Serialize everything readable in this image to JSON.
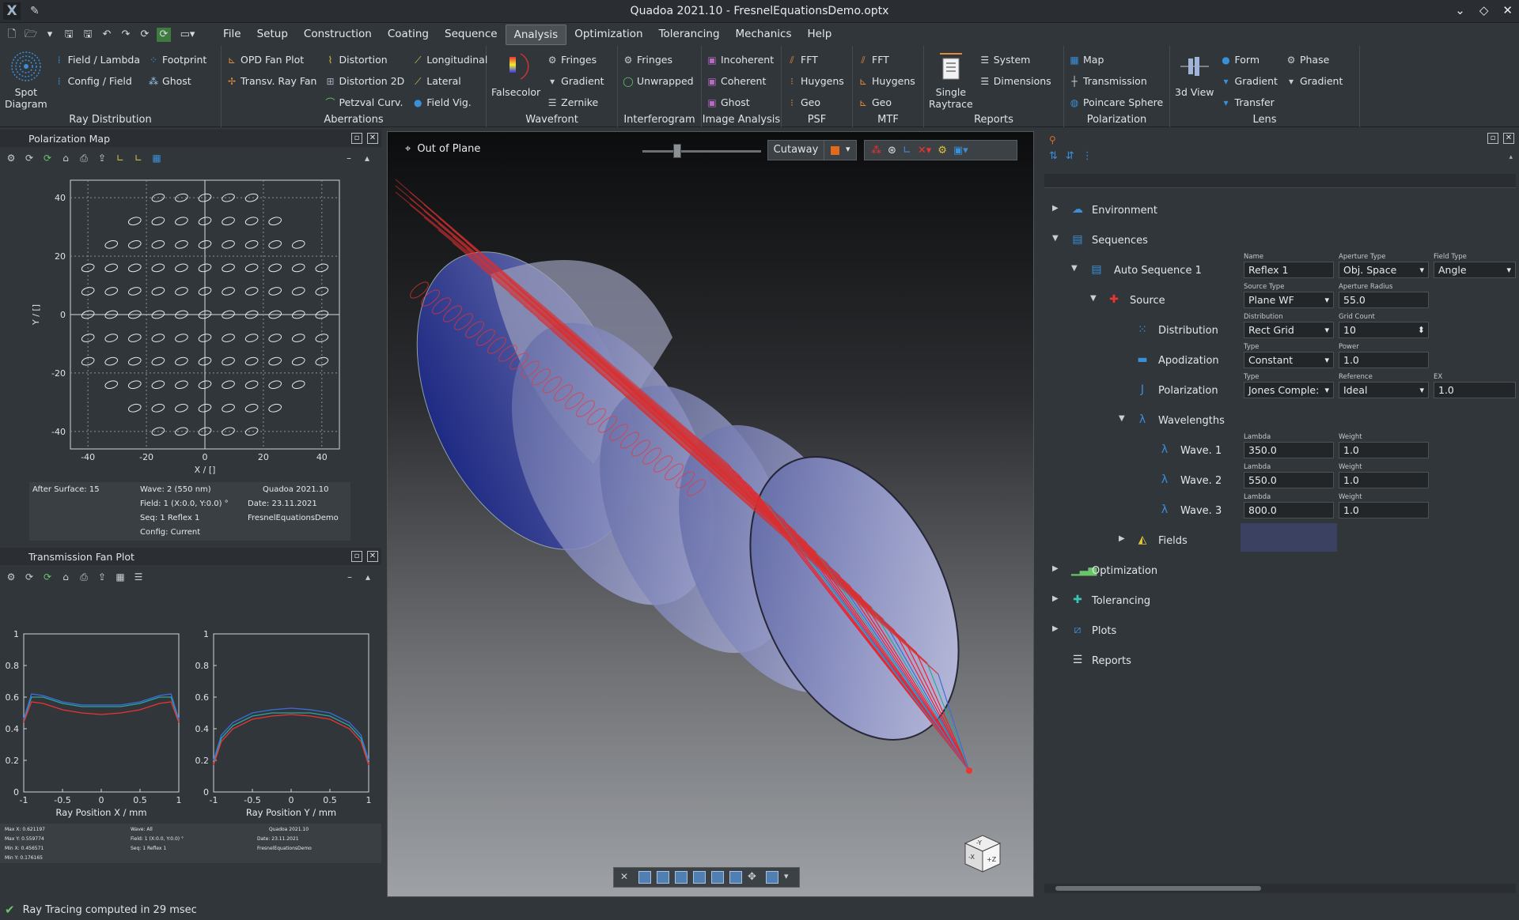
{
  "window": {
    "title": "Quadoa 2021.10 - FresnelEquationsDemo.optx"
  },
  "menu": [
    "File",
    "Setup",
    "Construction",
    "Coating",
    "Sequence",
    "Analysis",
    "Optimization",
    "Tolerancing",
    "Mechanics",
    "Help"
  ],
  "active_menu": "Analysis",
  "ribbon": {
    "ray_distribution": {
      "label": "Ray Distribution",
      "spot": "Spot\nDiagram",
      "items": [
        "Field / Lambda",
        "Config / Field",
        "Footprint",
        "Ghost"
      ]
    },
    "aberrations": {
      "label": "Aberrations",
      "items": [
        "OPD Fan Plot",
        "Transv. Ray Fan",
        "Distortion",
        "Distortion 2D",
        "Petzval Curv.",
        "Longitudinal",
        "Lateral",
        "Field Vig."
      ]
    },
    "wavefront": {
      "label": "Wavefront",
      "falsecolor": "Falsecolor",
      "items": [
        "Fringes",
        "Gradient",
        "Zernike"
      ]
    },
    "interferogram": {
      "label": "Interferogram",
      "items": [
        "Fringes",
        "Unwrapped"
      ]
    },
    "image_analysis": {
      "label": "Image Analysis",
      "items": [
        "Incoherent",
        "Coherent",
        "Ghost"
      ]
    },
    "psf": {
      "label": "PSF",
      "items": [
        "FFT",
        "Huygens",
        "Geo"
      ]
    },
    "mtf": {
      "label": "MTF",
      "items": [
        "FFT",
        "Huygens",
        "Geo"
      ]
    },
    "reports": {
      "label": "Reports",
      "single": "Single\nRaytrace",
      "items": [
        "System",
        "Dimensions"
      ]
    },
    "polarization": {
      "label": "Polarization",
      "items": [
        "Map",
        "Transmission",
        "Poincare Sphere"
      ]
    },
    "lens": {
      "label": "Lens",
      "view3d": "3d View",
      "items": [
        "Form",
        "Gradient",
        "Transfer",
        "Phase",
        "Gradient"
      ]
    }
  },
  "polmap": {
    "title": "Polarization Map",
    "xlabel": "X / []",
    "ylabel": "Y / []",
    "xticks": [
      "-40",
      "-20",
      "0",
      "20",
      "40"
    ],
    "yticks": [
      "40",
      "20",
      "0",
      "-20",
      "-40"
    ],
    "info": {
      "surface": "After Surface: 15",
      "wave": "Wave: 2 (550 nm)",
      "field": "Field: 1 (X:0.0, Y:0.0) °",
      "seq": "Seq: 1 Reflex 1",
      "config": "Config: Current",
      "version": "Quadoa 2021.10",
      "date": "Date: 23.11.2021",
      "file": "FresnelEquationsDemo"
    }
  },
  "fanplot": {
    "title": "Transmission Fan Plot",
    "left_xlabel": "Ray Position X / mm",
    "right_xlabel": "Ray Position Y / mm",
    "yticks": [
      "1",
      "0.8",
      "0.6",
      "0.4",
      "0.2",
      "0"
    ],
    "xticks": [
      "-1",
      "-0.5",
      "0",
      "0.5",
      "1"
    ],
    "info": {
      "maxx": "Max X: 0.621197",
      "maxy": "Max Y: 0.559774",
      "minx": "Min X: 0.456571",
      "miny": "Min Y: 0.176165",
      "wave": "Wave: All",
      "field": "Field: 1 (X:0.0, Y:0.0) °",
      "seq": "Seq: 1 Reflex 1",
      "version": "Quadoa 2021.10",
      "date": "Date: 23.11.2021",
      "file": "FresnelEquationsDemo"
    }
  },
  "chart_data": [
    {
      "type": "line",
      "xlabel": "Ray Position X / mm",
      "ylabel": "",
      "xlim": [
        -1,
        1
      ],
      "ylim": [
        0,
        1
      ],
      "x": [
        -1,
        -0.9,
        -0.75,
        -0.5,
        -0.25,
        0,
        0.25,
        0.5,
        0.75,
        0.9,
        1
      ],
      "series": [
        {
          "values": [
            0.45,
            0.6,
            0.6,
            0.56,
            0.54,
            0.54,
            0.54,
            0.56,
            0.6,
            0.6,
            0.45
          ]
        },
        {
          "values": [
            0.46,
            0.62,
            0.61,
            0.57,
            0.55,
            0.55,
            0.55,
            0.57,
            0.61,
            0.62,
            0.46
          ]
        },
        {
          "values": [
            0.44,
            0.57,
            0.56,
            0.52,
            0.5,
            0.49,
            0.5,
            0.52,
            0.56,
            0.57,
            0.44
          ]
        }
      ]
    },
    {
      "type": "line",
      "xlabel": "Ray Position Y / mm",
      "ylabel": "",
      "xlim": [
        -1,
        1
      ],
      "ylim": [
        0,
        1
      ],
      "x": [
        -1,
        -0.9,
        -0.75,
        -0.5,
        -0.25,
        0,
        0.25,
        0.5,
        0.75,
        0.9,
        1
      ],
      "series": [
        {
          "values": [
            0.18,
            0.34,
            0.42,
            0.48,
            0.5,
            0.5,
            0.5,
            0.48,
            0.42,
            0.34,
            0.18
          ]
        },
        {
          "values": [
            0.2,
            0.36,
            0.44,
            0.5,
            0.52,
            0.53,
            0.52,
            0.5,
            0.44,
            0.36,
            0.2
          ]
        },
        {
          "values": [
            0.17,
            0.32,
            0.4,
            0.46,
            0.48,
            0.49,
            0.48,
            0.46,
            0.4,
            0.32,
            0.17
          ]
        }
      ]
    }
  ],
  "viewport": {
    "out_of_plane": "Out of Plane",
    "cutaway": "Cutaway"
  },
  "tree": {
    "environment": "Environment",
    "sequences": "Sequences",
    "auto_seq": "Auto Sequence 1",
    "name_l": "Name",
    "name_v": "Reflex 1",
    "aptype_l": "Aperture Type",
    "aptype_v": "Obj. Space",
    "fieldtype_l": "Field Type",
    "fieldtype_v": "Angle",
    "source": "Source",
    "srctype_l": "Source Type",
    "srctype_v": "Plane WF",
    "aprad_l": "Aperture Radius",
    "aprad_v": "55.0",
    "distribution": "Distribution",
    "dist_l": "Distribution",
    "dist_v": "Rect Grid",
    "grid_l": "Grid Count",
    "grid_v": "10",
    "apodization": "Apodization",
    "apo_type_l": "Type",
    "apo_type_v": "Constant",
    "power_l": "Power",
    "power_v": "1.0",
    "polarization": "Polarization",
    "pol_type_l": "Type",
    "pol_type_v": "Jones Comple:",
    "ref_l": "Reference",
    "ref_v": "Ideal",
    "ex_l": "EX",
    "ex_v": "1.0",
    "wavelengths": "Wavelengths",
    "waves": [
      {
        "name": "Wave. 1",
        "lambda": "350.0",
        "weight": "1.0"
      },
      {
        "name": "Wave. 2",
        "lambda": "550.0",
        "weight": "1.0"
      },
      {
        "name": "Wave. 3",
        "lambda": "800.0",
        "weight": "1.0"
      }
    ],
    "lambda_l": "Lambda",
    "weight_l": "Weight",
    "fields": "Fields",
    "optimization": "Optimization",
    "tolerancing": "Tolerancing",
    "plots": "Plots",
    "reports": "Reports"
  },
  "status": {
    "text": "Ray Tracing computed in 29 msec"
  }
}
